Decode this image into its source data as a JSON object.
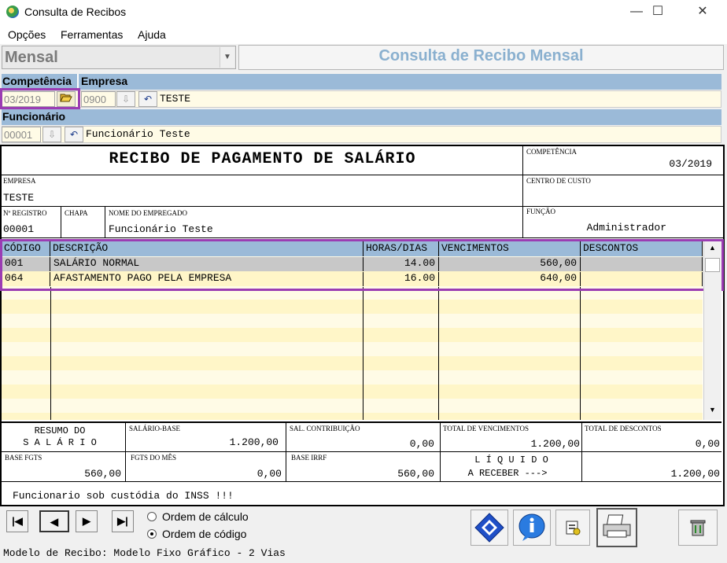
{
  "window": {
    "title": "Consulta de Recibos",
    "minimize": "—",
    "maximize": "☐",
    "close": "✕"
  },
  "menu": [
    {
      "label": "Opções"
    },
    {
      "label": "Ferramentas"
    },
    {
      "label": "Ajuda"
    }
  ],
  "mode": {
    "value": "Mensal",
    "header": "Consulta de Recibo Mensal"
  },
  "filters": {
    "competencia_label": "Competência",
    "competencia_value": "03/2019",
    "empresa_label": "Empresa",
    "empresa_code": "0900",
    "empresa_name": "TESTE",
    "funcionario_label": "Funcionário",
    "funcionario_code": "00001",
    "funcionario_name": "Funcionário Teste"
  },
  "receipt": {
    "title": "RECIBO DE PAGAMENTO DE SALÁRIO",
    "competencia_label": "COMPETÊNCIA",
    "competencia": "03/2019",
    "empresa_label": "EMPRESA",
    "empresa": "TESTE",
    "centro_label": "CENTRO DE CUSTO",
    "centro": "",
    "registro_label": "Nº REGISTRO",
    "registro": "00001",
    "chapa_label": "CHAPA",
    "chapa": "",
    "nome_label": "NOME DO EMPREGADO",
    "nome": "Funcionário Teste",
    "funcao_label": "FUNÇÃO",
    "funcao": "Administrador",
    "columns": [
      "CÓDIGO",
      "DESCRIÇÃO",
      "HORAS/DIAS",
      "VENCIMENTOS",
      "DESCONTOS"
    ],
    "rows": [
      {
        "codigo": "001",
        "descricao": "SALÁRIO NORMAL",
        "horas": "14.00",
        "venc": "560,00",
        "desc": ""
      },
      {
        "codigo": "064",
        "descricao": "AFASTAMENTO PAGO PELA EMPRESA",
        "horas": "16.00",
        "venc": "640,00",
        "desc": ""
      }
    ],
    "resumo_line1": "RESUMO DO",
    "resumo_line2": "S A L Á R I O",
    "salario_base_label": "SALÁRIO-BASE",
    "salario_base": "1.200,00",
    "sal_contrib_label": "SAL. CONTRIBUIÇÃO",
    "sal_contrib": "0,00",
    "total_venc_label": "TOTAL DE VENCIMENTOS",
    "total_venc": "1.200,00",
    "total_desc_label": "TOTAL DE DESCONTOS",
    "total_desc": "0,00",
    "base_fgts_label": "BASE FGTS",
    "base_fgts": "560,00",
    "fgts_mes_label": "FGTS DO MÊS",
    "fgts_mes": "0,00",
    "base_irrf_label": "BASE IRRF",
    "base_irrf": "560,00",
    "liquido_line1": "L Í Q U I D O",
    "liquido_line2": "A RECEBER --->",
    "liquido": "1.200,00",
    "message": "Funcionario sob custódia do INSS !!!"
  },
  "order": {
    "calc": "Ordem de cálculo",
    "code": "Ordem de código",
    "selected": "code"
  },
  "footer": {
    "model": "Modelo de Recibo: Modelo Fixo Gráfico - 2 Vias"
  }
}
